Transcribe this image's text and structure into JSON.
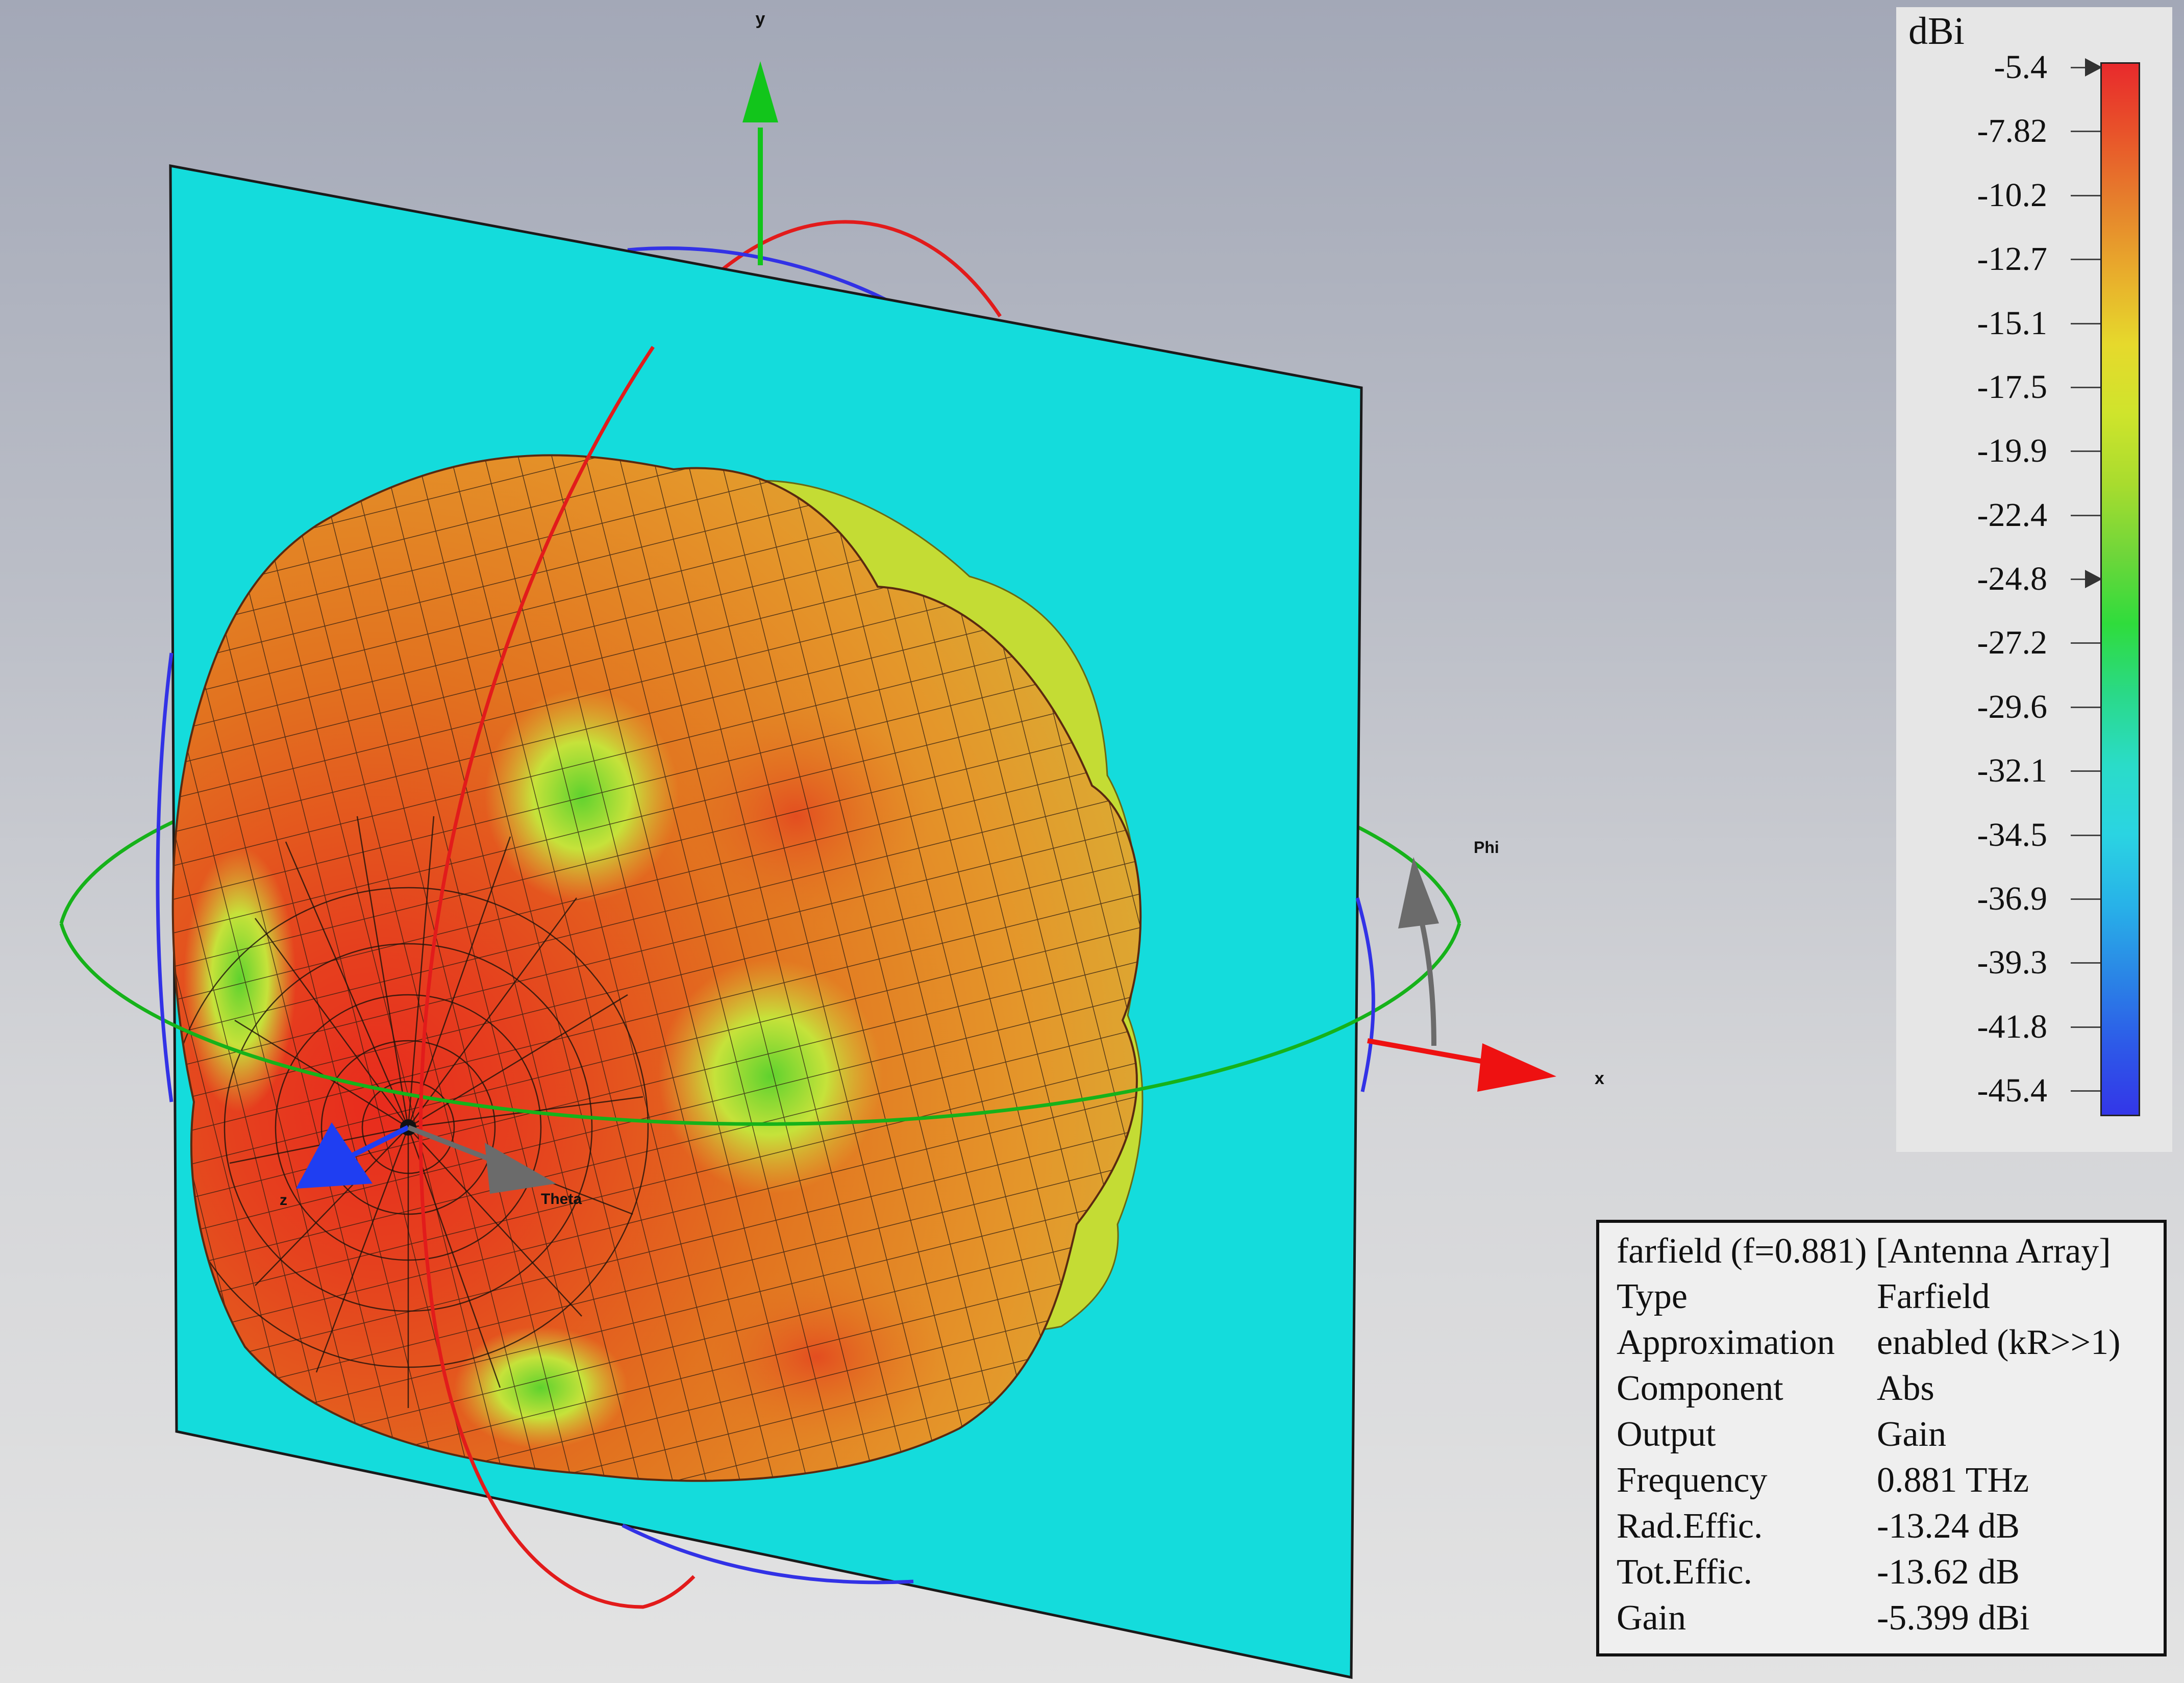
{
  "viewport": {
    "axes": {
      "x_label": "x",
      "y_label": "y",
      "z_label": "z",
      "theta_label": "Theta",
      "phi_label": "Phi"
    },
    "colors": {
      "plane": "#14dcdc",
      "theta_circle": "#e21b1b",
      "phi_circle": "#16b21a",
      "blue_circle": "#3232e6",
      "axis_x": "#ee1111",
      "axis_y": "#12c51b",
      "axis_z": "#1f3ef2",
      "pattern_peak": "#e8381e",
      "pattern_mid": "#e3831f",
      "pattern_low": "#c8e23a"
    }
  },
  "legend": {
    "unit": "dBi",
    "ticks": [
      "-5.4",
      "-7.82",
      "-10.2",
      "-12.7",
      "-15.1",
      "-17.5",
      "-19.9",
      "-22.4",
      "-24.8",
      "-27.2",
      "-29.6",
      "-32.1",
      "-34.5",
      "-36.9",
      "-39.3",
      "-41.8",
      "-45.4"
    ],
    "markers": [
      "-5.4",
      "-24.8"
    ],
    "gradient": [
      "#e82a2c",
      "#e8542a",
      "#e6812c",
      "#e8ad2c",
      "#e6d92c",
      "#cfe42c",
      "#a8dc2e",
      "#6fd63a",
      "#2fdc3c",
      "#2ad988",
      "#2adcc8",
      "#2ad4e2",
      "#28b2e8",
      "#2a86e6",
      "#2d5ae8",
      "#3336e8"
    ]
  },
  "info": {
    "title": "farfield (f=0.881) [Antenna Array]",
    "rows": [
      {
        "key": "Type",
        "value": "Farfield"
      },
      {
        "key": "Approximation",
        "value": "enabled (kR>>1)"
      },
      {
        "key": "Component",
        "value": "Abs"
      },
      {
        "key": "Output",
        "value": "Gain"
      },
      {
        "key": "Frequency",
        "value": "0.881 THz"
      },
      {
        "key": "Rad.Effic.",
        "value": "-13.24 dB"
      },
      {
        "key": "Tot.Effic.",
        "value": "-13.62 dB"
      },
      {
        "key": "Gain",
        "value": "-5.399 dBi"
      }
    ]
  }
}
